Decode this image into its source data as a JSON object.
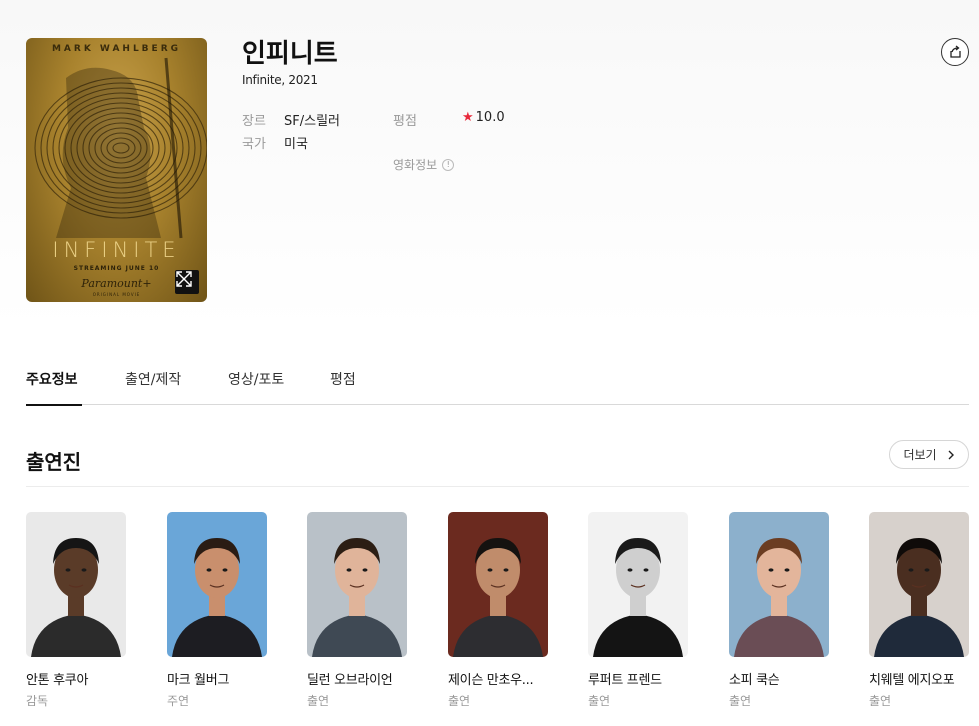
{
  "movie": {
    "title": "인피니트",
    "subtitle": "Infinite, 2021",
    "genre_label": "장르",
    "genre_value": "SF/스릴러",
    "country_label": "국가",
    "country_value": "미국",
    "rating_label": "평점",
    "rating_value": "10.0",
    "info_link": "영화정보",
    "info_icon_glyph": "!"
  },
  "poster": {
    "top_text": "MARK WAHLBERG",
    "title_text": "INFINITE",
    "streaming": "STREAMING JUNE 10",
    "brand": "Paramount+",
    "brand_sub": "ORIGINAL MOVIE"
  },
  "tabs": [
    {
      "label": "주요정보",
      "active": true
    },
    {
      "label": "출연/제작",
      "active": false
    },
    {
      "label": "영상/포토",
      "active": false
    },
    {
      "label": "평점",
      "active": false
    }
  ],
  "cast_section": {
    "title": "출연진",
    "more_label": "더보기"
  },
  "cast": [
    {
      "name": "안톤 후쿠아",
      "role": "감독",
      "bg": "#e9e9e9",
      "shirt": "#2b2b2b",
      "skin": "#5a3b28",
      "hair": "#151515"
    },
    {
      "name": "마크 월버그",
      "role": "주연",
      "bg": "#6aa6d8",
      "shirt": "#1d1d22",
      "skin": "#c98f6d",
      "hair": "#2a1c14"
    },
    {
      "name": "딜런 오브라이언",
      "role": "출연",
      "bg": "#b9c1c8",
      "shirt": "#3f4954",
      "skin": "#e0b49a",
      "hair": "#2c1e14"
    },
    {
      "name": "제이슨 만초우...",
      "role": "출연",
      "bg": "#6b2a1f",
      "shirt": "#2d2d31",
      "skin": "#c08c6b",
      "hair": "#151210"
    },
    {
      "name": "루퍼트 프렌드",
      "role": "출연",
      "bg": "#f2f2f2",
      "shirt": "#141414",
      "skin": "#cfcfcf",
      "hair": "#1a1a1a"
    },
    {
      "name": "소피 쿡슨",
      "role": "출연",
      "bg": "#8cb0cc",
      "shirt": "#6a4d55",
      "skin": "#e3b59b",
      "hair": "#6b3d22"
    },
    {
      "name": "치웨텔 에지오포",
      "role": "출연",
      "bg": "#d7d1cc",
      "shirt": "#1f2a3a",
      "skin": "#4a2e20",
      "hair": "#0f0b09"
    }
  ],
  "colors": {
    "star": "#e8293b",
    "muted": "#9a9a9a"
  }
}
